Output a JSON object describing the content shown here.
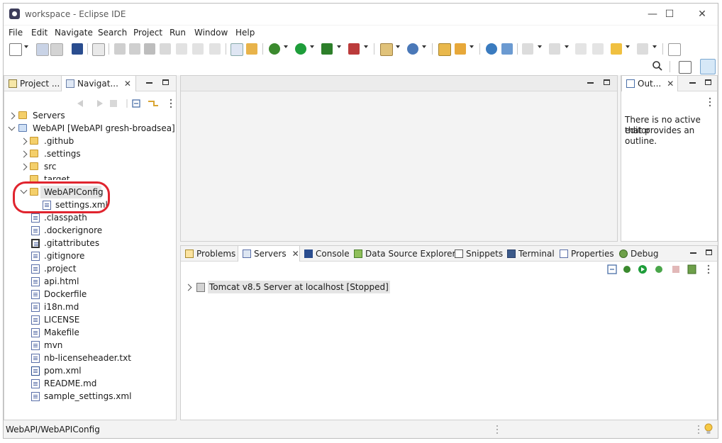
{
  "window": {
    "title": "workspace - Eclipse IDE",
    "minimize": "—",
    "maximize": "☐",
    "close": "✕"
  },
  "menu": [
    "File",
    "Edit",
    "Navigate",
    "Search",
    "Project",
    "Run",
    "Window",
    "Help"
  ],
  "left_panel": {
    "tabs": [
      {
        "label": "Project ..."
      },
      {
        "label": "Navigat...",
        "close": "✕"
      }
    ],
    "tree": [
      {
        "label": "Servers"
      },
      {
        "label": "WebAPI [WebAPI gresh-broadsea]"
      },
      {
        "label": ".github"
      },
      {
        "label": ".settings"
      },
      {
        "label": "src"
      },
      {
        "label": "target"
      },
      {
        "label": "WebAPIConfig"
      },
      {
        "label": "settings.xml"
      },
      {
        "label": ".classpath"
      },
      {
        "label": ".dockerignore"
      },
      {
        "label": ".gitattributes"
      },
      {
        "label": ".gitignore"
      },
      {
        "label": ".project"
      },
      {
        "label": "api.html"
      },
      {
        "label": "Dockerfile"
      },
      {
        "label": "i18n.md"
      },
      {
        "label": "LICENSE"
      },
      {
        "label": "Makefile"
      },
      {
        "label": "mvn"
      },
      {
        "label": "nb-licenseheader.txt"
      },
      {
        "label": "pom.xml"
      },
      {
        "label": "README.md"
      },
      {
        "label": "sample_settings.xml"
      }
    ]
  },
  "outline_panel": {
    "tab": "Out...",
    "close": "✕",
    "message": [
      "There is no active editor",
      "that provides an",
      "outline."
    ]
  },
  "bottom_panel": {
    "tabs": [
      "Problems",
      "Servers",
      "Console",
      "Data Source Explorer",
      "Snippets",
      "Terminal",
      "Properties",
      "Debug"
    ],
    "close": "✕",
    "server_entry": "Tomcat v8.5 Server at localhost  [Stopped]"
  },
  "status": {
    "path": "WebAPI/WebAPIConfig"
  },
  "colors": {
    "accent_red": "#e0242e",
    "folder": "#f4cf6a",
    "run_green": "#1e9d3a"
  }
}
